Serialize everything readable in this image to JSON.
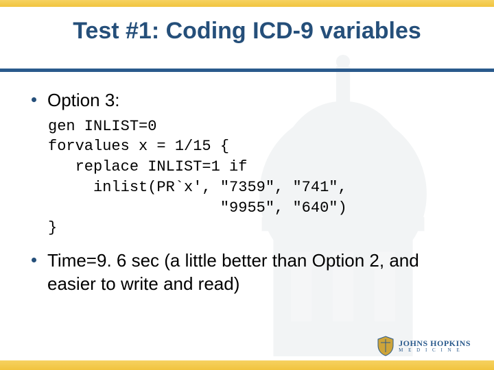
{
  "title": "Test #1: Coding ICD-9 variables",
  "bullets": {
    "option": "Option 3:",
    "time": "Time=9. 6 sec (a little better than Option 2, and easier to write and read)"
  },
  "code": "gen INLIST=0\nforvalues x = 1/15 {\n   replace INLIST=1 if\n     inlist(PR`x', \"7359\", \"741\",\n                   \"9955\", \"640\")\n}",
  "logo": {
    "line1": "JOHNS HOPKINS",
    "line2": "M  E  D  I  C  I  N  E"
  }
}
